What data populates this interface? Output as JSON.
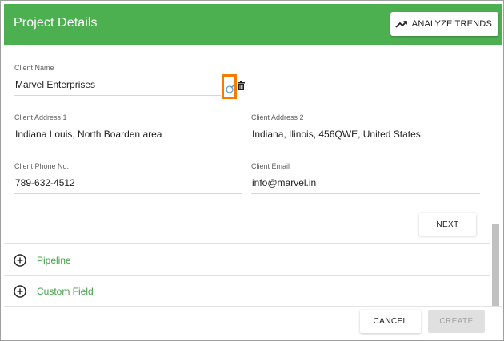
{
  "header": {
    "title": "Project Details",
    "analyze_button": {
      "label": "ANALYZE TRENDS",
      "icon": "trending-up-icon"
    },
    "color": "#4caf50"
  },
  "form": {
    "client_name": {
      "label": "Client Name",
      "value": "Marvel Enterprises"
    },
    "client_address_1": {
      "label": "Client Address 1",
      "value": "Indiana Louis, North Boarden area"
    },
    "client_address_2": {
      "label": "Client Address 2",
      "value": "Indiana, Ilinois, 456QWE, United States"
    },
    "client_phone": {
      "label": "Client Phone No.",
      "value": "789-632-4512"
    },
    "client_email": {
      "label": "Client Email",
      "value": "info@marvel.in"
    },
    "name_actions": {
      "edit_icon": "edit-icon",
      "delete_icon": "trash-icon",
      "highlight_color": "#f57c00"
    }
  },
  "next_button": {
    "label": "NEXT"
  },
  "sections": [
    {
      "label": "Pipeline",
      "icon": "plus-circle-icon"
    },
    {
      "label": "Custom Field",
      "icon": "plus-circle-icon"
    }
  ],
  "footer": {
    "cancel_label": "CANCEL",
    "create_label": "CREATE"
  }
}
